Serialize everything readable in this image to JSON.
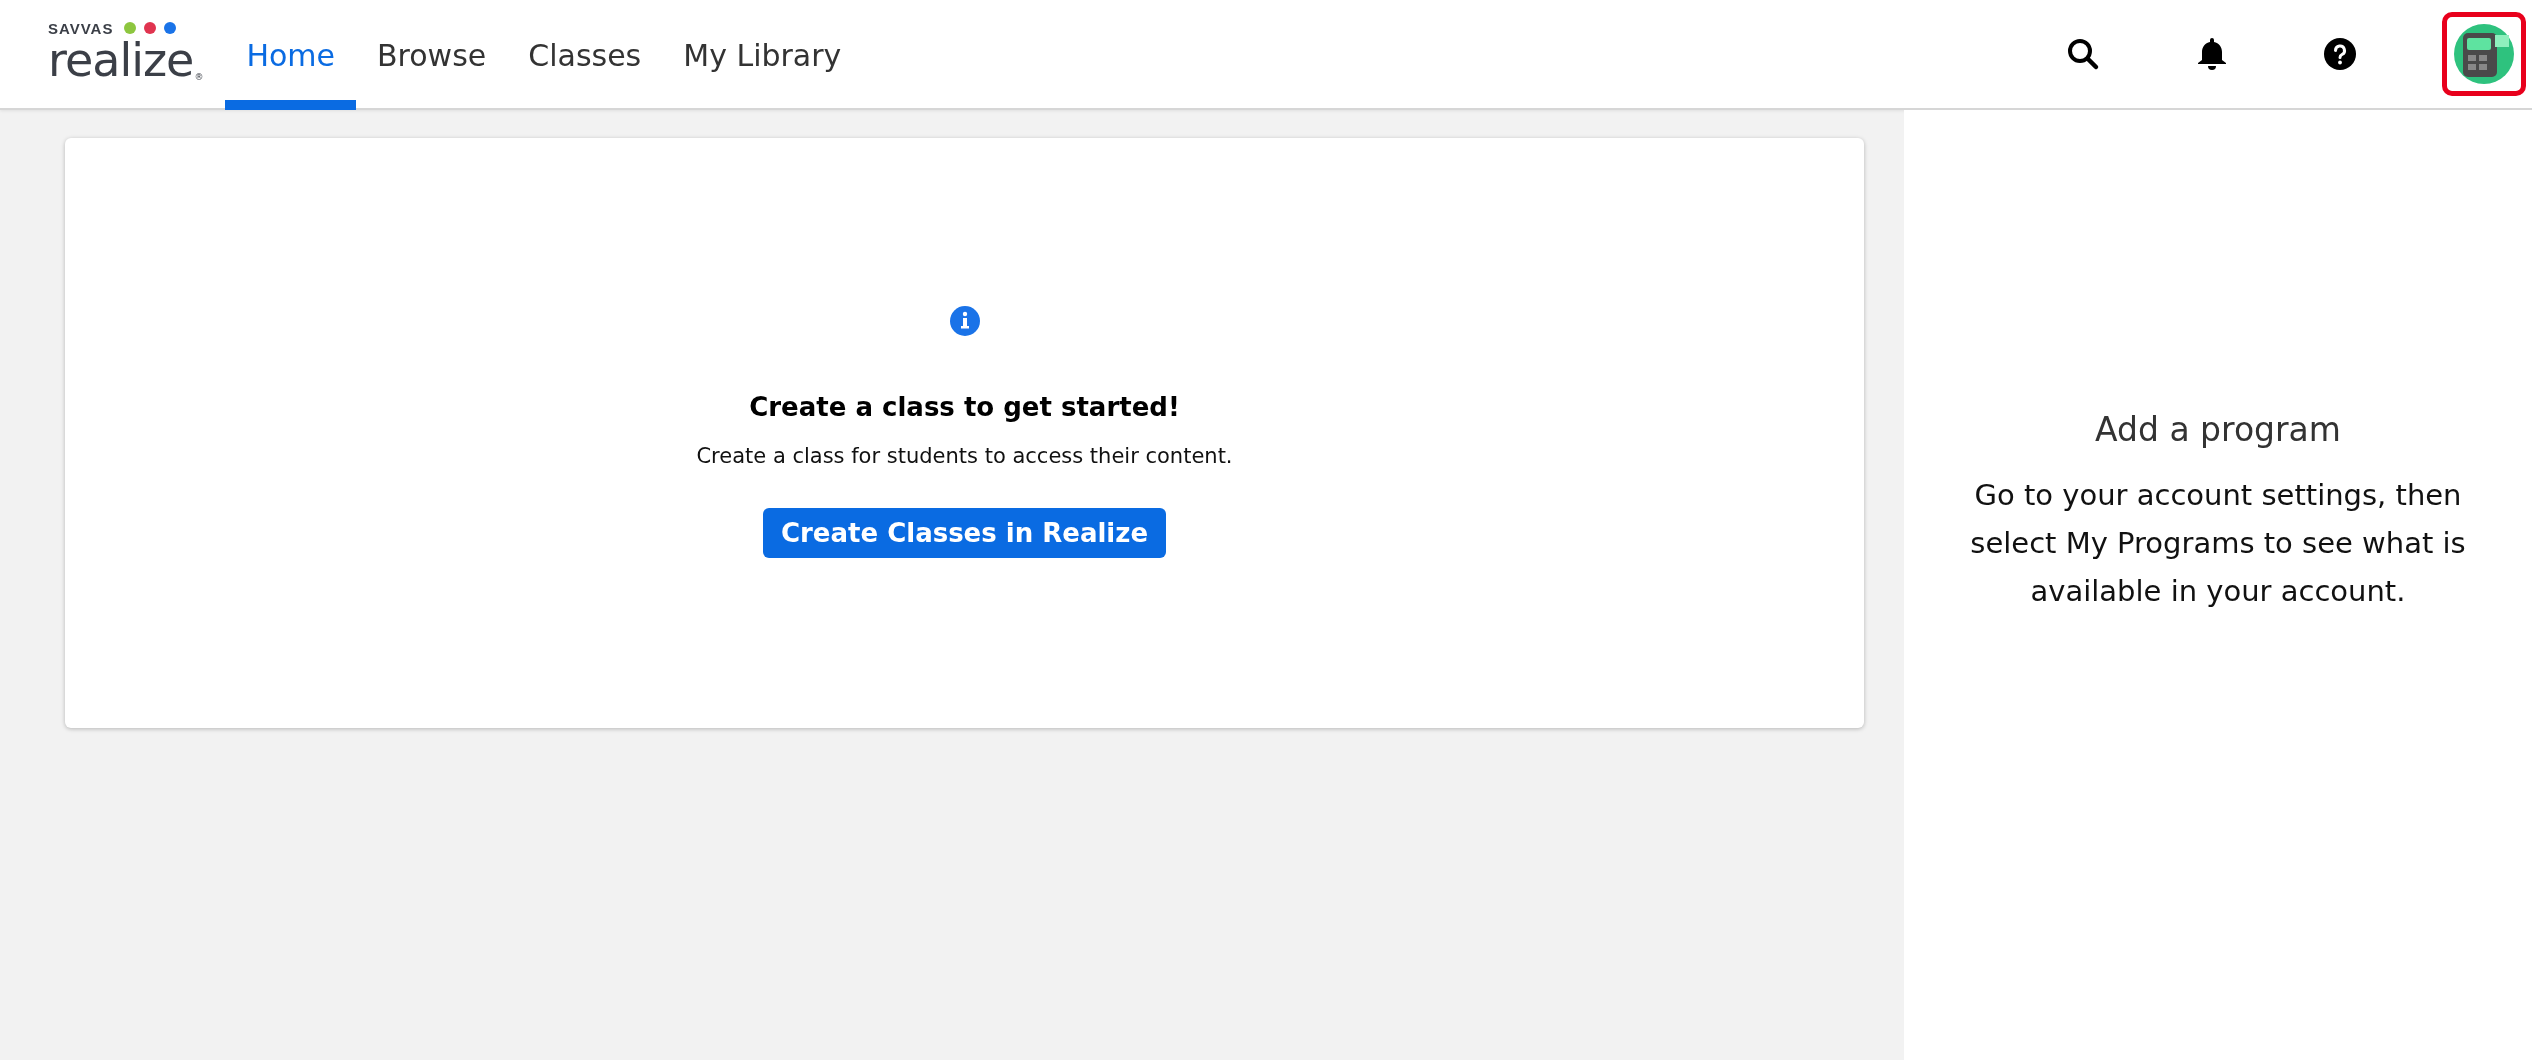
{
  "logo": {
    "brand": "SAVVAS",
    "product": "realize",
    "mark": "®"
  },
  "nav": [
    {
      "label": "Home",
      "selected": true
    },
    {
      "label": "Browse",
      "selected": false
    },
    {
      "label": "Classes",
      "selected": false
    },
    {
      "label": "My Library",
      "selected": false
    }
  ],
  "avatar": {
    "highlighted": true
  },
  "empty_state": {
    "title": "Create a class to get started!",
    "message": "Create a class for students to access their content.",
    "button": "Create Classes in Realize"
  },
  "side_panel": {
    "title": "Add a program",
    "message": "Go to your account settings, then select My Programs to see what is available in your account."
  }
}
